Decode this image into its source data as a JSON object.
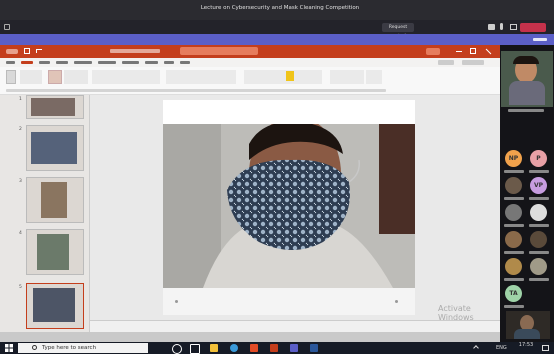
{
  "meeting": {
    "title": "Lecture on Cybersecurity and Mask Cleaning Competition",
    "request_control_label": "Request control",
    "share_banner_text": "",
    "leave_label": "",
    "colors": {
      "banner": "#5b5fc7",
      "leave": "#c4314b",
      "ppt_brand": "#c43e1c"
    }
  },
  "participants": [
    {
      "initials": "NP",
      "color": "#f1a24c"
    },
    {
      "initials": "P",
      "color": "#e8a0a6"
    },
    {
      "initials": "",
      "color": "#6b5a4a"
    },
    {
      "initials": "VP",
      "color": "#c79de0"
    },
    {
      "initials": "",
      "color": "#777"
    },
    {
      "initials": "",
      "color": "#ddd"
    },
    {
      "initials": "",
      "color": "#8a6a4a"
    },
    {
      "initials": "",
      "color": "#5a4a3a"
    },
    {
      "initials": "",
      "color": "#b08a4a"
    },
    {
      "initials": "",
      "color": "#a09a88"
    },
    {
      "initials": "TA",
      "color": "#9fd3a8"
    }
  ],
  "slides": [
    {
      "number": "1"
    },
    {
      "number": "2"
    },
    {
      "number": "3"
    },
    {
      "number": "4"
    },
    {
      "number": "5"
    }
  ],
  "watermark": {
    "title": "Activate Windows",
    "subtitle": ""
  },
  "taskbar": {
    "search_placeholder": "Type here to search",
    "lang": "ENG",
    "time": "17:53",
    "date": ""
  },
  "icons": [
    "windows-icon",
    "search-icon",
    "cortana-icon",
    "task-view-icon",
    "file-explorer-icon",
    "chrome-icon",
    "edge-icon",
    "powerpoint-icon",
    "teams-icon",
    "word-icon"
  ]
}
